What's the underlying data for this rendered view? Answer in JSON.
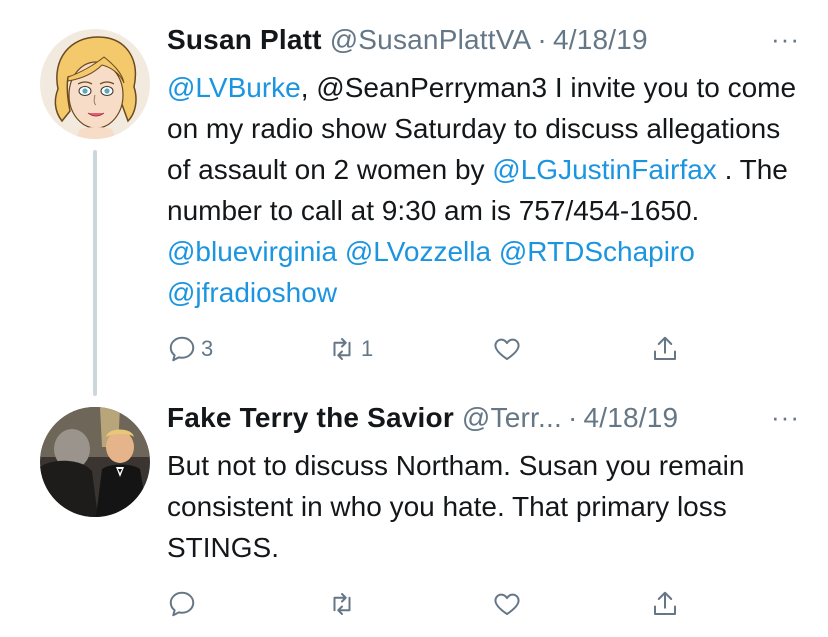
{
  "tweets": [
    {
      "author_name": "Susan Platt",
      "author_handle": "@SusanPlattVA",
      "separator": "·",
      "date": "4/18/19",
      "more_icon": "more-options-icon",
      "more_label": "···",
      "text_segments": [
        {
          "type": "mention",
          "text": "@LVBurke"
        },
        {
          "type": "text",
          "text": ", @SeanPerryman3 I invite you to come on my radio show Saturday to discuss allegations of assault on 2 women by "
        },
        {
          "type": "mention",
          "text": "@LGJustinFairfax"
        },
        {
          "type": "text",
          "text": " . The number to call at 9:30 am is 757/454-1650. "
        },
        {
          "type": "mention",
          "text": "@bluevirginia"
        },
        {
          "type": "text",
          "text": " "
        },
        {
          "type": "mention",
          "text": "@LVozzella"
        },
        {
          "type": "text",
          "text": " "
        },
        {
          "type": "mention",
          "text": "@RTDSchapiro"
        },
        {
          "type": "text",
          "text": " "
        },
        {
          "type": "mention",
          "text": "@jfradioshow"
        }
      ],
      "replies": "3",
      "retweets": "1",
      "likes": "",
      "avatar_icon": "cartoon-woman-avatar"
    },
    {
      "author_name": "Fake Terry the Savior",
      "author_handle": "@Terr...",
      "separator": "·",
      "date": "4/18/19",
      "more_icon": "more-options-icon",
      "more_label": "···",
      "text_segments": [
        {
          "type": "text",
          "text": "But not to discuss Northam. Susan you remain consistent in who you hate. That primary loss STINGS."
        }
      ],
      "replies": "",
      "retweets": "",
      "likes": "",
      "avatar_icon": "photo-avatar"
    }
  ],
  "colors": {
    "link": "#1b95e0",
    "secondary": "#657786",
    "text": "#14171a",
    "thread_line": "#ccd6dd"
  }
}
